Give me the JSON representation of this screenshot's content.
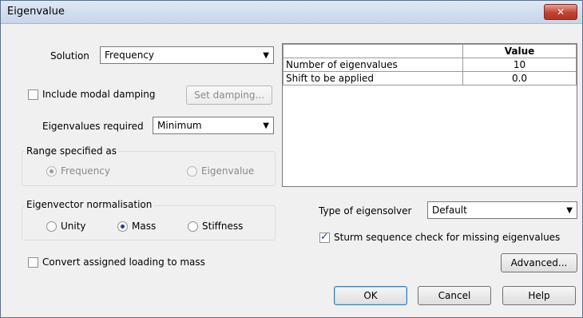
{
  "window": {
    "title": "Eigenvalue",
    "close_glyph": "✕"
  },
  "solution": {
    "label": "Solution",
    "value": "Frequency"
  },
  "modal_damping": {
    "label": "Include modal damping",
    "checked": false,
    "button": "Set damping..."
  },
  "eigenvalues_required": {
    "label": "Eigenvalues required",
    "value": "Minimum"
  },
  "range": {
    "title": "Range specified as",
    "options": [
      "Frequency",
      "Eigenvalue"
    ],
    "selected": "Frequency"
  },
  "normalisation": {
    "title": "Eigenvector normalisation",
    "options": [
      "Unity",
      "Mass",
      "Stiffness"
    ],
    "selected": "Mass"
  },
  "convert_loading": {
    "label": "Convert assigned loading to mass",
    "checked": false
  },
  "table": {
    "header": "Value",
    "rows": [
      {
        "name": "Number of eigenvalues",
        "value": "10"
      },
      {
        "name": "Shift to be applied",
        "value": "0.0"
      }
    ]
  },
  "eigensolver": {
    "label": "Type of eigensolver",
    "value": "Default"
  },
  "sturm": {
    "label": "Sturm sequence check for missing eigenvalues",
    "checked": true
  },
  "buttons": {
    "advanced": "Advanced...",
    "ok": "OK",
    "cancel": "Cancel",
    "help": "Help"
  },
  "icons": {
    "dropdown": "▼"
  }
}
